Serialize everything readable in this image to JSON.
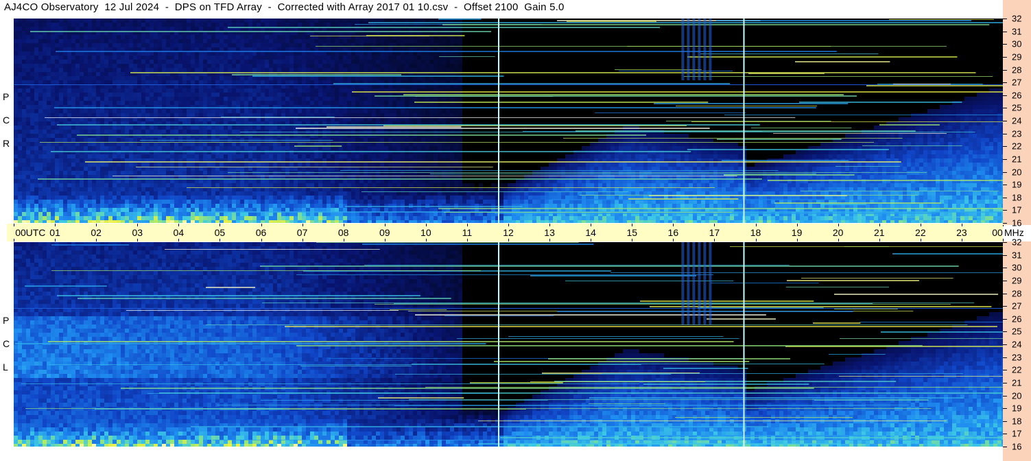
{
  "title": "AJ4CO Observatory  12 Jul 2024  -  DPS on TFD Array  -  Corrected with Array 2017 01 10.csv  -  Offset 2100  Gain 5.0",
  "panels": {
    "top": {
      "polarization_label": [
        "P",
        "C",
        "R"
      ]
    },
    "bottom": {
      "polarization_label": [
        "P",
        "C",
        "L"
      ]
    }
  },
  "time_axis": {
    "labels": [
      "00",
      "UTC",
      "01",
      "02",
      "03",
      "04",
      "05",
      "06",
      "07",
      "08",
      "09",
      "10",
      "11",
      "12",
      "13",
      "14",
      "15",
      "16",
      "17",
      "18",
      "19",
      "20",
      "21",
      "22",
      "23",
      "00"
    ],
    "unit": "UTC"
  },
  "frequency_axis": {
    "unit": "MHz",
    "ticks": [
      "32",
      "31",
      "30",
      "29",
      "28",
      "27",
      "26",
      "25",
      "24",
      "23",
      "22",
      "21",
      "20",
      "19",
      "18",
      "17",
      "16"
    ]
  },
  "colors": {
    "background": "#000000",
    "low_intensity": "#0a2a9a",
    "mid_intensity": "#1e7ff0",
    "high_intensity": "#e6f04a",
    "marker_line": "#c8fbff",
    "strip": "#fffcc4",
    "scale": "#fbd2ba"
  },
  "chart_data": {
    "type": "heatmap",
    "title": "AJ4CO Observatory  12 Jul 2024  -  DPS on TFD Array  -  Corrected with Array 2017 01 10.csv  -  Offset 2100  Gain 5.0",
    "xlabel": "UTC",
    "ylabel": "MHz",
    "x_range": [
      0,
      24
    ],
    "y_range": [
      16,
      32
    ],
    "panels": [
      "RCP",
      "LCP"
    ],
    "marker_lines_utc": [
      11.75,
      17.7
    ],
    "daytime_background_end_utc": {
      "RCP": 10.8,
      "LCP": 10.8
    }
  }
}
